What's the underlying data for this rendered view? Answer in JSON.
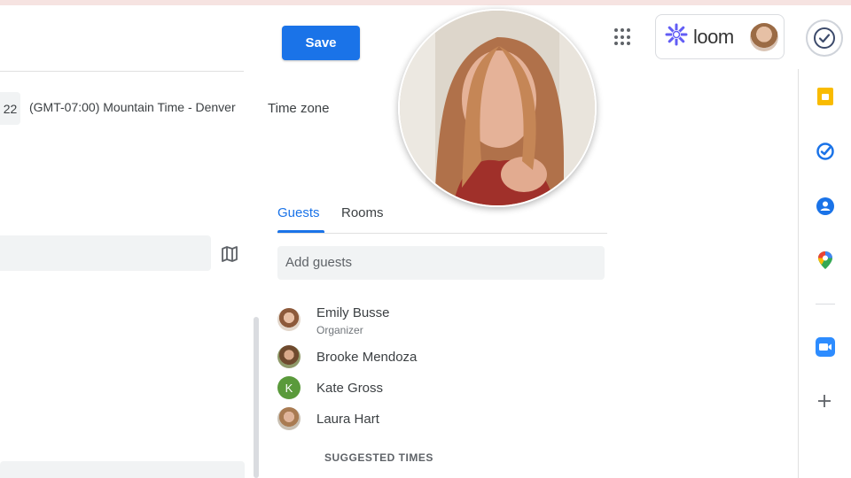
{
  "header": {
    "save_label": "Save",
    "loom_label": "loom"
  },
  "time_zone": {
    "chip_text": "22",
    "value": "(GMT-07:00) Mountain Time - Denver",
    "label": "Time zone"
  },
  "guests_panel": {
    "tabs": [
      {
        "label": "Guests",
        "active": true
      },
      {
        "label": "Rooms",
        "active": false
      }
    ],
    "add_guests_placeholder": "Add guests",
    "guests": [
      {
        "name": "Emily Busse",
        "role": "Organizer",
        "avatar": "photo"
      },
      {
        "name": "Brooke Mendoza",
        "role": "",
        "avatar": "photo"
      },
      {
        "name": "Kate Gross",
        "role": "",
        "avatar": "letter",
        "initial": "K",
        "color": "#5a9a3b"
      },
      {
        "name": "Laura Hart",
        "role": "",
        "avatar": "photo"
      }
    ],
    "suggested_times_label": "SUGGESTED TIMES"
  },
  "side_panel": {
    "icons": [
      "keep-icon",
      "tasks-icon",
      "contacts-icon",
      "maps-icon",
      "zoom-icon",
      "add-icon"
    ]
  },
  "colors": {
    "accent": "#1a73e8",
    "keep": "#f9bb00",
    "loom": "#625df5",
    "zoom": "#2d8cff"
  }
}
